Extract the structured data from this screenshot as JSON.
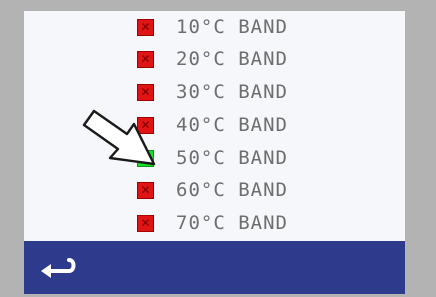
{
  "bands": [
    {
      "label": "10°C BAND",
      "checked": false
    },
    {
      "label": "20°C BAND",
      "checked": false
    },
    {
      "label": "30°C BAND",
      "checked": false
    },
    {
      "label": "40°C BAND",
      "checked": false
    },
    {
      "label": "50°C BAND",
      "checked": true
    },
    {
      "label": "60°C BAND",
      "checked": false
    },
    {
      "label": "70°C BAND",
      "checked": false
    }
  ],
  "marks": {
    "on": "✓",
    "off": "✕"
  },
  "colors": {
    "frame": "#b3b3b3",
    "screen_bg": "#f5f7fa",
    "bottom_bar": "#2e3a8c",
    "checked": "#19e02a",
    "unchecked": "#e01414",
    "label_text": "#6e6e6e"
  },
  "icons": {
    "pointer": "pointer-arrow-icon",
    "back": "back-arrow-icon"
  }
}
